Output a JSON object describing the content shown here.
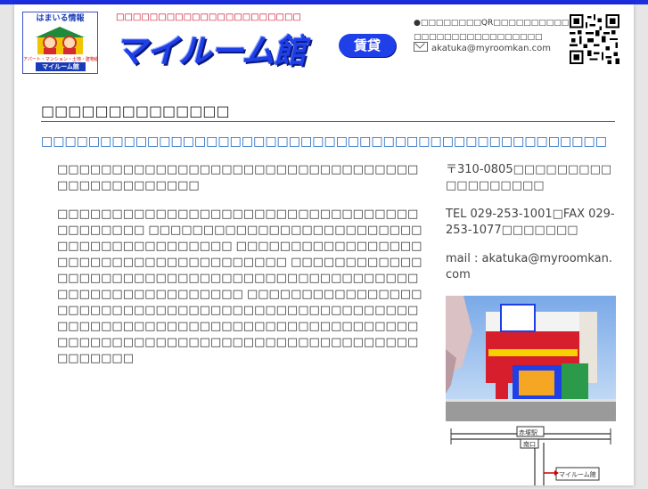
{
  "header": {
    "logo": {
      "top_text": "はまいる情報",
      "tiny_text": "アパート・マンション・土地・建物総合ショップ",
      "brand": "マイルーム館"
    },
    "tagline": "□□□□□□□□□□□□□□□□□□□□□□",
    "title": "マイルーム館",
    "badge": "賃貸",
    "qr_note": "●□□□□□□□□QR□□□□□□□□□□URL□□□□ □□□□□□□□□□□□□□□□□",
    "email": "akatuka@myroomkan.com"
  },
  "main": {
    "heading": "□□□□□□□□□□□□□□",
    "subheading": "□□□□□□□□□□□□□□□□□□□□□□□□□□□□□□□□□□□□□□□□□□□□□□□□",
    "paragraphs": [
      "□□□□□□□□□□□□□□□□□□□□□□□□□□□□□□□□□□□□□□□□□□□□□□",
      "□□□□□□□□□□□□□□□□□□□□□□□□□□□□□□□□□□□□□□□□□ □□□□□□□□□□□□□□□□□□□□□□□□□□□□□□□□□□□□□□□□□ □□□□□□□□□□□□□□□□□□□□□□□□□□□□□□□□□□□□□□ □□□□□□□□□□□□□□□□□□□□□□□□□□□□□□□□□□□□□□□□□□□□□□□□□□□□□□□□□□□□□□ □□□□□□□□□□□□□□□□□□□□□□□□□□□□□□□□□□□□□□□□□□□□□□□□□□□□□□□□□□□□□□□□□□□□□□□□□□□□□□□□□□□□□□□□□□□□□□□□□□□□□□□□□□□□□□□□□□□□□□□□□□"
    ]
  },
  "sidebar": {
    "address": "〒310-0805□□□□□□□□□□□□□□□□□□",
    "tel_fax": "TEL 029-253-1001□FAX 029-253-1077□□□□□□□",
    "mail": "mail : akatuka@myroomkan.com",
    "map_labels": {
      "crossing": "赤塚駅",
      "exit": "南口",
      "shop": "マイルーム館"
    }
  },
  "colors": {
    "topbar": "#1b2ee0",
    "title_blue": "#1f3fe8",
    "tagline_red": "#c8001e",
    "subheading_blue": "#1a64c0"
  }
}
